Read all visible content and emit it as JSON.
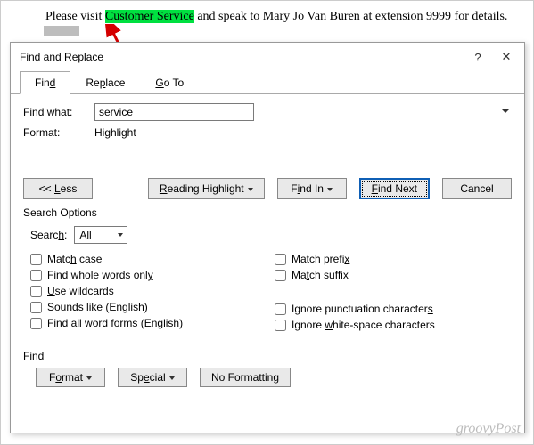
{
  "doc": {
    "pre": "Please visit ",
    "highlighted": "Customer Service",
    "post": " and speak to Mary Jo Van Buren at extension 9999 for details."
  },
  "dialog": {
    "title": "Find and Replace",
    "tabs": {
      "find": "Find",
      "replace": "Replace",
      "goto": "Go To"
    },
    "find_what_label": "Find what:",
    "find_what_value": "service",
    "format_label": "Format:",
    "format_value": "Highlight",
    "buttons": {
      "less": "<< Less",
      "reading": "Reading Highlight",
      "find_in": "Find In",
      "find_next": "Find Next",
      "cancel": "Cancel"
    },
    "search_options_title": "Search Options",
    "search_label": "Search:",
    "search_value": "All",
    "checks_left": {
      "match_case": "Match case",
      "whole_words": "Find whole words only",
      "wildcards": "Use wildcards",
      "sounds_like": "Sounds like (English)",
      "word_forms": "Find all word forms (English)"
    },
    "checks_right": {
      "prefix": "Match prefix",
      "suffix": "Match suffix",
      "punct": "Ignore punctuation characters",
      "ws": "Ignore white-space characters"
    },
    "find_section": "Find",
    "footer": {
      "format": "Format",
      "special": "Special",
      "nofmt": "No Formatting"
    }
  },
  "watermark": "groovyPost"
}
